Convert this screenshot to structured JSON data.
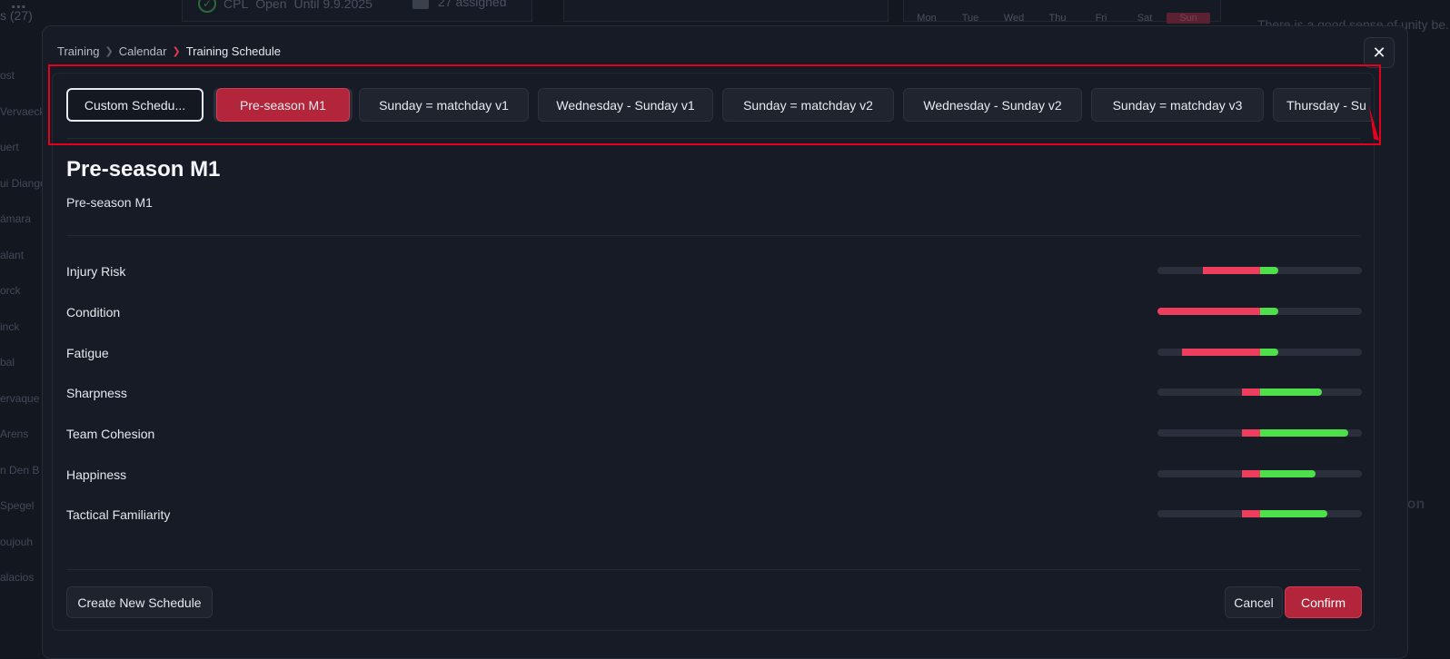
{
  "background": {
    "team_title": "...",
    "team_count": "s (27)",
    "status_label": "CPL",
    "status_value": "Open",
    "status_until": "Until 9.9.2025",
    "assigned": "27 assigned",
    "weekdays": [
      "Mon",
      "Tue",
      "Wed",
      "Thu",
      "Fri",
      "Sat",
      "Sun"
    ],
    "note": "There is a good sense of unity be... have littl... things",
    "player_names": [
      "ost",
      "Vervaeck",
      "uert",
      "ui Diango",
      "ámara",
      "alant",
      "orck",
      "inck",
      "bal",
      "ervaque",
      "Arens",
      "n Den B",
      "Spegel",
      "oujouh",
      "alacios"
    ],
    "side_text": "ation"
  },
  "modal": {
    "breadcrumb": [
      "Training",
      "Calendar",
      "Training Schedule"
    ],
    "close_icon": "close-icon"
  },
  "tabs": [
    {
      "label": "Custom Schedu...",
      "state": "custom"
    },
    {
      "label": "Pre-season M1",
      "state": "active"
    },
    {
      "label": "Sunday = matchday v1",
      "state": "normal"
    },
    {
      "label": "Wednesday - Sunday v1",
      "state": "normal"
    },
    {
      "label": "Sunday = matchday v2",
      "state": "normal"
    },
    {
      "label": "Wednesday - Sunday v2",
      "state": "normal"
    },
    {
      "label": "Sunday = matchday v3",
      "state": "normal"
    },
    {
      "label": "Thursday - Su",
      "state": "normal"
    }
  ],
  "detail": {
    "title": "Pre-season M1",
    "subtitle": "Pre-season M1"
  },
  "stats": [
    {
      "label": "Injury Risk",
      "negative": 0.28,
      "positive": 0.09
    },
    {
      "label": "Condition",
      "negative": 0.5,
      "positive": 0.09
    },
    {
      "label": "Fatigue",
      "negative": 0.38,
      "positive": 0.09
    },
    {
      "label": "Sharpness",
      "negative": 0.09,
      "positive": 0.3
    },
    {
      "label": "Team Cohesion",
      "negative": 0.09,
      "positive": 0.43
    },
    {
      "label": "Happiness",
      "negative": 0.09,
      "positive": 0.27
    },
    {
      "label": "Tactical Familiarity",
      "negative": 0.09,
      "positive": 0.33
    }
  ],
  "colors": {
    "accent": "#b3253a",
    "negative_bar": "#ee3d5d",
    "positive_bar": "#4ee04a",
    "highlight_box": "#e5001b"
  },
  "footer": {
    "create_label": "Create New Schedule",
    "cancel_label": "Cancel",
    "confirm_label": "Confirm"
  }
}
